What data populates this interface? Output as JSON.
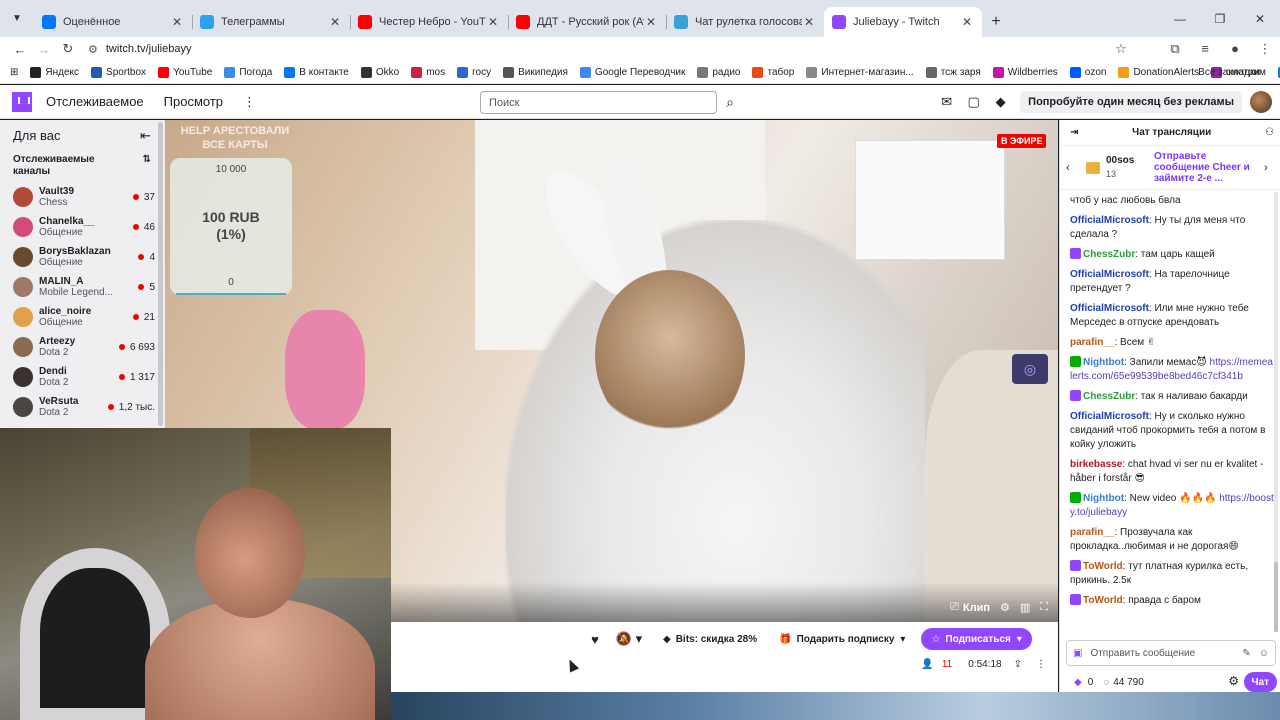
{
  "browser": {
    "tabs": [
      {
        "title": "Оценённое",
        "color": "#0077ff"
      },
      {
        "title": "Телеграммы",
        "color": "#2aa3ef"
      },
      {
        "title": "Честер Небро - YouTube",
        "color": "#ff0000"
      },
      {
        "title": "ДДТ - Русский рок (Аудио) - Y",
        "color": "#ff0000"
      },
      {
        "title": "Чат рулетка голосовая — Nek",
        "color": "#3aa0d8"
      },
      {
        "title": "Juliebayy - Twitch",
        "color": "#9146ff"
      }
    ],
    "new_tab": "+",
    "url": "twitch.tv/juliebayy",
    "bookmarks": [
      {
        "label": "Яндекс",
        "color": "#222"
      },
      {
        "label": "Sportbox",
        "color": "#1e5fb4"
      },
      {
        "label": "YouTube",
        "color": "#ff0000"
      },
      {
        "label": "Погода",
        "color": "#3a8ee6"
      },
      {
        "label": "В контакте",
        "color": "#0077ff"
      },
      {
        "label": "Okko",
        "color": "#333"
      },
      {
        "label": "mos",
        "color": "#cc2244"
      },
      {
        "label": "госу",
        "color": "#2a6bd2"
      },
      {
        "label": "Википедия",
        "color": "#555"
      },
      {
        "label": "Google Переводчик",
        "color": "#4285f4"
      },
      {
        "label": "радио",
        "color": "#777"
      },
      {
        "label": "табор",
        "color": "#e64a19"
      },
      {
        "label": "Интернет-магазин...",
        "color": "#888"
      },
      {
        "label": "тсж заря",
        "color": "#666"
      },
      {
        "label": "Wildberries",
        "color": "#cb11ab"
      },
      {
        "label": "ozon",
        "color": "#005bff"
      },
      {
        "label": "DonationAlerts",
        "color": "#f59c1a"
      },
      {
        "label": "смотрим",
        "color": "#8e24aa"
      },
      {
        "label": "Циан",
        "color": "#1a73e8"
      }
    ],
    "all_bookmarks": "Все закладки"
  },
  "twitch_nav": {
    "following": "Отслеживаемое",
    "browse": "Просмотр",
    "search_placeholder": "Поиск",
    "promo": "Попробуйте один месяц без рекламы"
  },
  "sidebar": {
    "title": "Для вас",
    "section": "Отслеживаемые каналы",
    "channels": [
      {
        "name": "Vault39",
        "game": "Chess",
        "viewers": "37",
        "color": "#b24a3a"
      },
      {
        "name": "Chanelka__",
        "game": "Общение",
        "viewers": "46",
        "color": "#d24c7a"
      },
      {
        "name": "BorysBaklazan",
        "game": "Общение",
        "viewers": "4",
        "color": "#6b4a30"
      },
      {
        "name": "MALIN_A",
        "game": "Mobile Legend...",
        "viewers": "5",
        "color": "#a07868"
      },
      {
        "name": "alice_noire",
        "game": "Общение",
        "viewers": "21",
        "color": "#e3a04a"
      },
      {
        "name": "Arteezy",
        "game": "Dota 2",
        "viewers": "6 693",
        "color": "#8a6a50"
      },
      {
        "name": "Dendi",
        "game": "Dota 2",
        "viewers": "1 317",
        "color": "#3a3230"
      },
      {
        "name": "VeRsuta",
        "game": "Dota 2",
        "viewers": "1,2 тыс.",
        "color": "#4c4642"
      }
    ]
  },
  "video": {
    "live": "В ЭФИРЕ",
    "overlay_header": "HELP АРЕСТОВАЛИ ВСЕ КАРТЫ",
    "donation_top": "10 000",
    "donation_amount": "100 RUB",
    "donation_percent": "(1%)",
    "donation_bottom": "0",
    "clip": "Клип"
  },
  "under": {
    "bits": "Bits: скидка 28%",
    "gift": "Подарить подписку",
    "subscribe": "Подписаться",
    "viewers": "11",
    "uptime": "0:54:18"
  },
  "chat": {
    "title": "Чат трансляции",
    "pinned_user": "00sos",
    "pinned_count": "13",
    "pinned_msg": "Отправьте сообщение Cheer и займите 2-е ...",
    "messages": [
      {
        "nick": "",
        "text": "чтоб у нас любовь бвла",
        "color": "#1f1f23",
        "badge": ""
      },
      {
        "nick": "OfficialMicrosoft",
        "text": "Ну ты для меня что сделала ?",
        "color": "#1e3fb5",
        "badge": ""
      },
      {
        "nick": "ChessZubr",
        "text": "там царь кащей",
        "color": "#2b9a3e",
        "badge": "#9146ff"
      },
      {
        "nick": "OfficialMicrosoft",
        "text": "На тарелочнице претендует ?",
        "color": "#1e3fb5",
        "badge": ""
      },
      {
        "nick": "OfficialMicrosoft",
        "text": "Или мне нужно тебе Мерседес в отпуске арендовать",
        "color": "#1e3fb5",
        "badge": ""
      },
      {
        "nick": "parafin__",
        "text": "Всем ✌",
        "color": "#b8561a",
        "badge": ""
      },
      {
        "nick": "Nightbot",
        "text": "Запили мемас😈",
        "color": "#3a7fcc",
        "badge": "#00ad03",
        "link": "https://memealerts.com/65e99539be8bed46c7cf341b"
      },
      {
        "nick": "ChessZubr",
        "text": "так я наливаю бакарди",
        "color": "#2b9a3e",
        "badge": "#9146ff"
      },
      {
        "nick": "OfficialMicrosoft",
        "text": "Ну и сколько нужно свиданий чтоб прокормить тебя а потом в койку уложить",
        "color": "#1e3fb5",
        "badge": ""
      },
      {
        "nick": "birkebasse",
        "text": "chat hvad vi ser nu er kvalitet - håber i forstår 😎",
        "color": "#b3162d",
        "badge": ""
      },
      {
        "nick": "Nightbot",
        "text": "New video 🔥🔥🔥",
        "color": "#3a7fcc",
        "badge": "#00ad03",
        "link": "https://boosty.to/juliebayy"
      },
      {
        "nick": "parafin__",
        "text": "Прозвучала как прокладка..любимая и не дорогая😄",
        "color": "#b8561a",
        "badge": ""
      },
      {
        "nick": "ToWorld",
        "text": "тут платная курилка есть, прикинь. 2.5к",
        "color": "#b8561a",
        "badge": "#9146ff"
      },
      {
        "nick": "ToWorld",
        "text": "правда с баром",
        "color": "#b8561a",
        "badge": "#9146ff"
      }
    ],
    "input_placeholder": "Отправить сообщение",
    "bits_count": "0",
    "points": "44 790",
    "send": "Чат"
  }
}
